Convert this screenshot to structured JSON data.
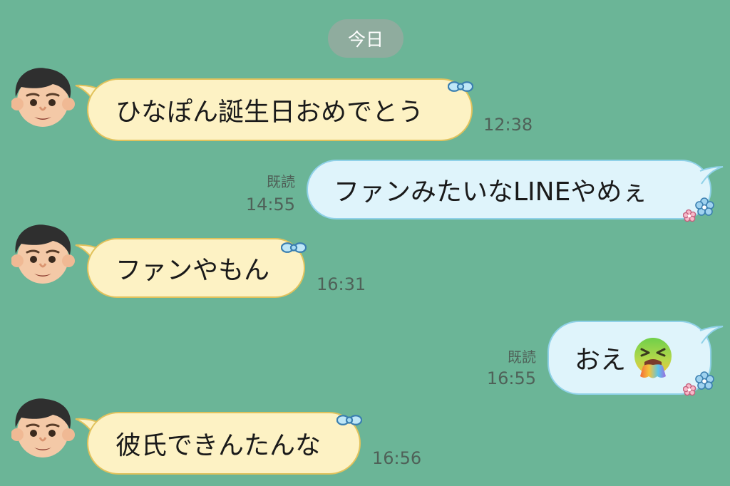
{
  "date_label": "今日",
  "messages": [
    {
      "side": "in",
      "text": "ひなぽん誕生日おめでとう",
      "time": "12:38"
    },
    {
      "side": "out",
      "text": "ファンみたいなLINEやめぇ",
      "read": "既読",
      "time": "14:55"
    },
    {
      "side": "in",
      "text": "ファンやもん",
      "time": "16:31"
    },
    {
      "side": "out",
      "text": "おえ",
      "emoji": "vomiting-face-emoji",
      "read": "既読",
      "time": "16:55"
    },
    {
      "side": "in",
      "text": "彼氏できんたんな",
      "time": "16:56"
    }
  ],
  "icons": {
    "avatar": "boy-face-avatar-icon",
    "incoming_decoration": "blue-bow-icon",
    "outgoing_decoration": "flowers-icon"
  },
  "colors": {
    "background": "#6bb597",
    "incoming_bubble": "#fdf2c4",
    "incoming_border": "#e1c25c",
    "outgoing_bubble": "#dff4fb",
    "outgoing_border": "#8fd1e8",
    "date_pill": "#8fac9e",
    "timestamp": "#4f6158"
  }
}
